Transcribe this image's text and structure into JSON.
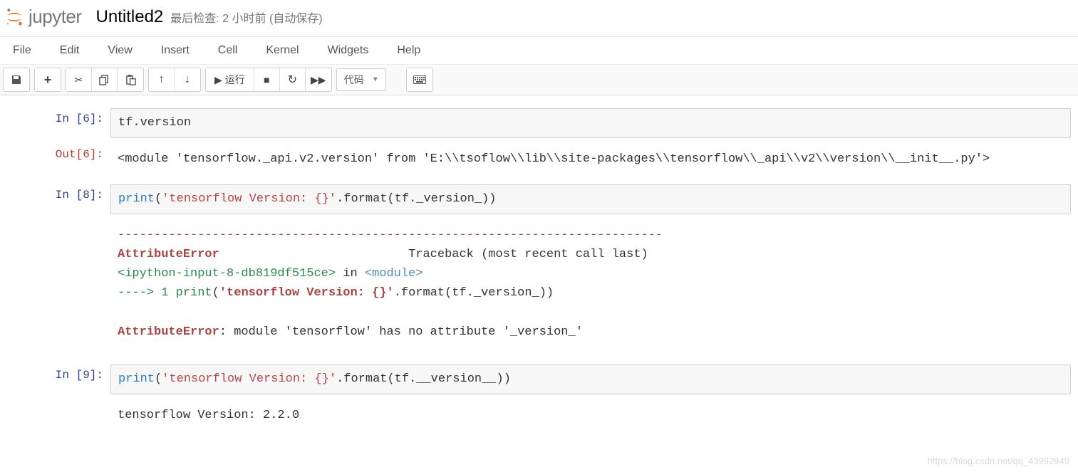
{
  "brand": "jupyter",
  "title": "Untitled2",
  "checkpoint": "最后检查: 2 小时前   (自动保存)",
  "menu": {
    "file": "File",
    "edit": "Edit",
    "view": "View",
    "insert": "Insert",
    "cell": "Cell",
    "kernel": "Kernel",
    "widgets": "Widgets",
    "help": "Help"
  },
  "toolbar": {
    "run_label": "运行",
    "cell_type": "代码"
  },
  "cells": [
    {
      "in_prompt": "In  [6]:",
      "code_plain": "tf.version",
      "out_prompt": "Out[6]:",
      "output": "<module 'tensorflow._api.v2.version' from 'E:\\\\tsoflow\\\\lib\\\\site-packages\\\\tensorflow\\\\_api\\\\v2\\\\version\\\\__init__.py'>"
    },
    {
      "in_prompt": "In  [8]:",
      "code": {
        "fn": "print",
        "open": "(",
        "str": "'tensorflow Version: {}'",
        "rest": ".format(tf._version_))"
      },
      "error": {
        "sep": "---------------------------------------------------------------------------",
        "name": "AttributeError",
        "trace_label": "                          Traceback (most recent call last)",
        "loc": "<ipython-input-8-db819df515ce>",
        "in_word": " in ",
        "module": "<module>",
        "arrow": "----> 1 ",
        "line_fn": "print",
        "line_open": "(",
        "line_str": "'tensorflow Version: {}'",
        "line_rest": ".format(tf._version_))",
        "msg_name": "AttributeError",
        "msg_rest": ": module 'tensorflow' has no attribute '_version_'"
      }
    },
    {
      "in_prompt": "In  [9]:",
      "code": {
        "fn": "print",
        "open": "(",
        "str": "'tensorflow Version: {}'",
        "rest": ".format(tf.__version__))"
      },
      "output": "tensorflow Version: 2.2.0"
    }
  ],
  "watermark": "https://blog.csdn.net/qq_43992949"
}
